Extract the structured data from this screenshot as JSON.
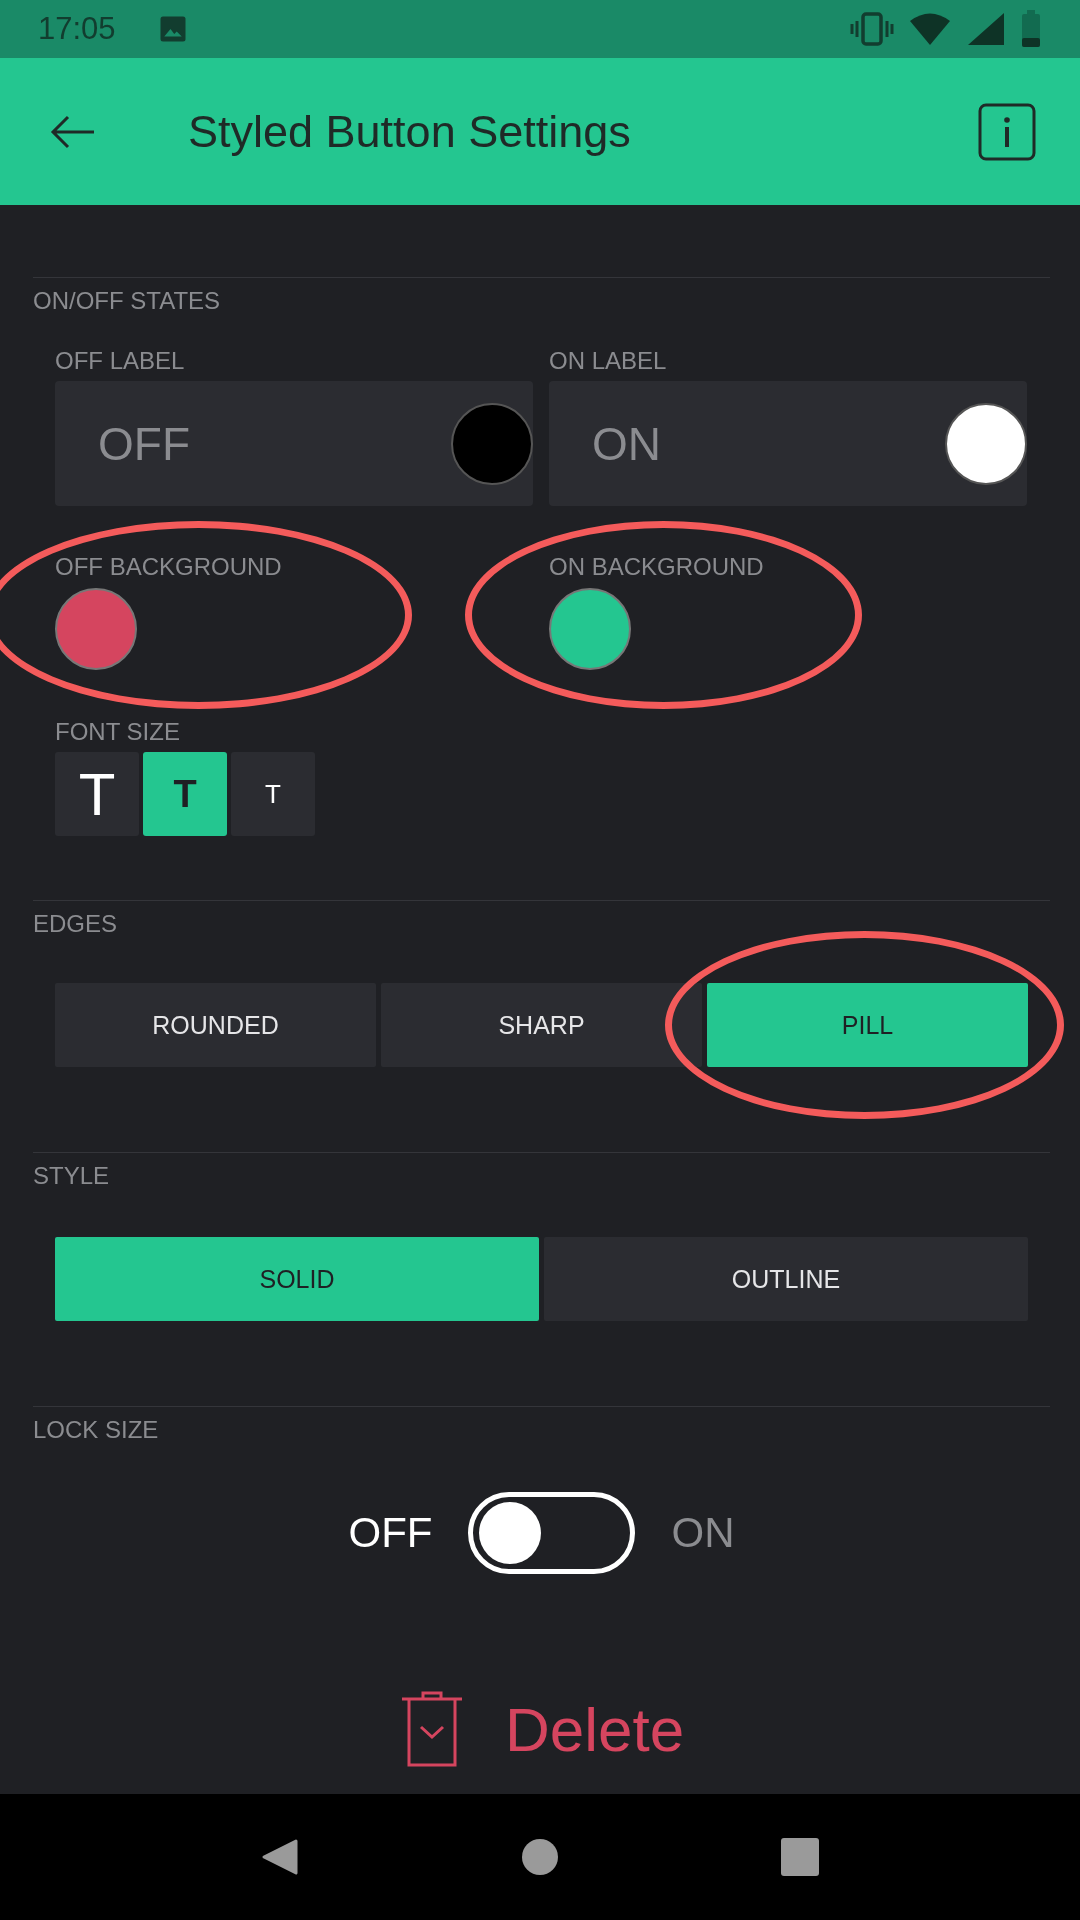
{
  "status_bar": {
    "time": "17:05"
  },
  "app_bar": {
    "title": "Styled Button Settings"
  },
  "sections": [
    {
      "kind": "onoff",
      "title": "ON/OFF STATES",
      "labels": [
        {
          "caption": "OFF LABEL",
          "value": "OFF",
          "color": "#000000"
        },
        {
          "caption": "ON LABEL",
          "value": "ON",
          "color": "#ffffff"
        }
      ],
      "backgrounds": [
        {
          "caption": "OFF BACKGROUND",
          "color": "#d5455f",
          "circled": true
        },
        {
          "caption": "ON BACKGROUND",
          "color": "#24c690",
          "circled": true
        }
      ],
      "font_size": {
        "caption": "FONT SIZE",
        "options": [
          {
            "label": "T",
            "selected": false
          },
          {
            "label": "T",
            "selected": true
          },
          {
            "label": "T",
            "selected": false
          }
        ]
      }
    },
    {
      "kind": "segmented",
      "title": "EDGES",
      "options": [
        {
          "label": "ROUNDED",
          "selected": false,
          "circled": false
        },
        {
          "label": "SHARP",
          "selected": false,
          "circled": false
        },
        {
          "label": "PILL",
          "selected": true,
          "circled": true
        }
      ]
    },
    {
      "kind": "segmented",
      "title": "STYLE",
      "options": [
        {
          "label": "SOLID",
          "selected": true,
          "circled": false
        },
        {
          "label": "OUTLINE",
          "selected": false,
          "circled": false
        }
      ]
    },
    {
      "kind": "switch",
      "title": "LOCK SIZE",
      "off_label": "OFF",
      "on_label": "ON",
      "on": false
    }
  ],
  "delete_button": {
    "label": "Delete"
  }
}
